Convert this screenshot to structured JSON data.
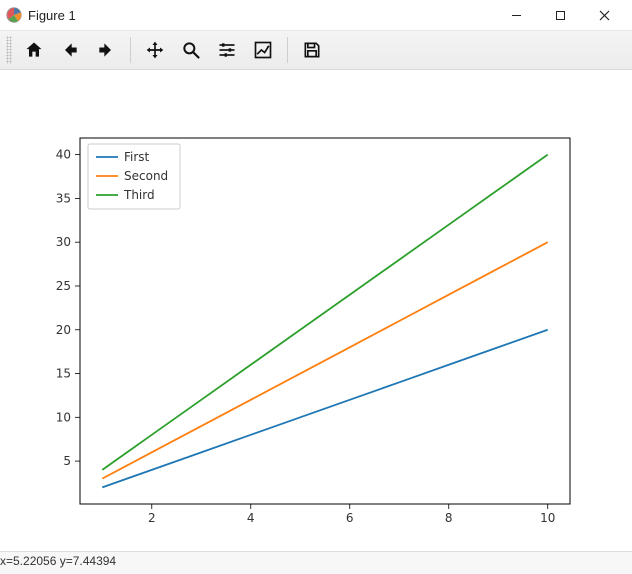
{
  "window": {
    "title": "Figure 1"
  },
  "toolbar": {
    "home": "Home",
    "back": "Back",
    "forward": "Forward",
    "pan": "Pan",
    "zoom": "Zoom",
    "subplots": "Configure subplots",
    "axes": "Edit axis",
    "save": "Save"
  },
  "status": {
    "text": "x=5.22056    y=7.44394"
  },
  "chart_data": {
    "type": "line",
    "x": [
      1,
      2,
      3,
      4,
      5,
      6,
      7,
      8,
      9,
      10
    ],
    "series": [
      {
        "name": "First",
        "color": "#1f77b4",
        "values": [
          2,
          4,
          6,
          8,
          10,
          12,
          14,
          16,
          18,
          20
        ]
      },
      {
        "name": "Second",
        "color": "#ff7f0e",
        "values": [
          3,
          6,
          9,
          12,
          15,
          18,
          21,
          24,
          27,
          30
        ]
      },
      {
        "name": "Third",
        "color": "#2ca02c",
        "values": [
          4,
          8,
          12,
          16,
          20,
          24,
          28,
          32,
          36,
          40
        ]
      }
    ],
    "xticks": [
      2,
      4,
      6,
      8,
      10
    ],
    "yticks": [
      5,
      10,
      15,
      20,
      25,
      30,
      35,
      40
    ],
    "xlim": [
      0.55,
      10.45
    ],
    "ylim": [
      0.1,
      41.9
    ],
    "xlabel": "",
    "ylabel": "",
    "title": "",
    "legend_loc": "upper left"
  }
}
